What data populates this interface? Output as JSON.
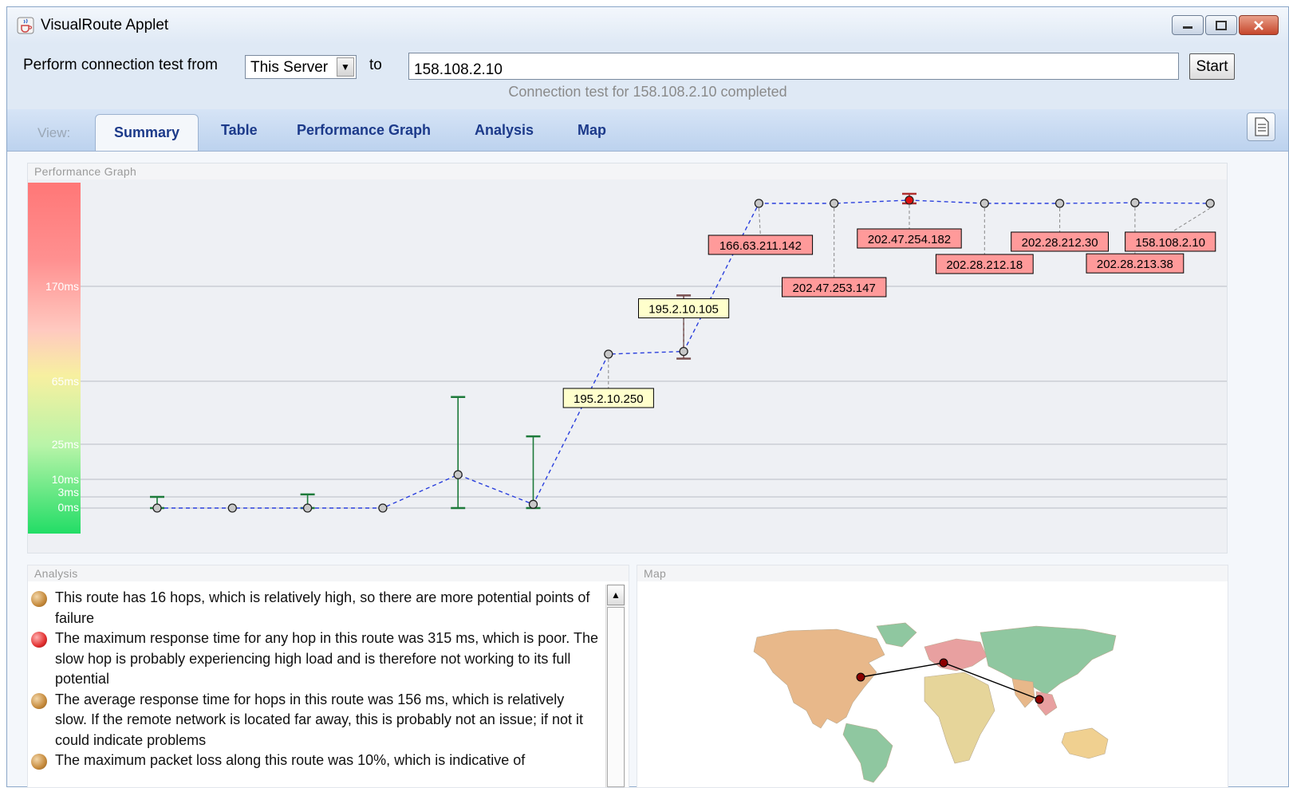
{
  "window": {
    "title": "VisualRoute Applet",
    "app_icon": "java-cup-icon"
  },
  "connection": {
    "from_label": "Perform connection test from",
    "from_value": "This Server",
    "to_label": "to",
    "target": "158.108.2.10",
    "start_label": "Start",
    "status": "Connection test for 158.108.2.10 completed"
  },
  "view": {
    "label": "View:",
    "tabs": [
      {
        "label": "Summary",
        "active": true
      },
      {
        "label": "Table"
      },
      {
        "label": "Performance Graph"
      },
      {
        "label": "Analysis"
      },
      {
        "label": "Map"
      }
    ]
  },
  "graph": {
    "title": "Performance Graph",
    "y_ticks": [
      "0ms",
      "3ms",
      "10ms",
      "25ms",
      "65ms",
      "170ms"
    ],
    "colors": {
      "good": "#22dd66",
      "mid": "#f7f0a0",
      "bad": "#ff7777",
      "line": "#2a3fdd"
    },
    "hops": [
      {
        "hop": 1,
        "ms": 0,
        "min": 0,
        "max": 3,
        "label": ""
      },
      {
        "hop": 2,
        "ms": 0,
        "min": 0,
        "max": 0,
        "label": ""
      },
      {
        "hop": 3,
        "ms": 0,
        "min": 0,
        "max": 4,
        "label": ""
      },
      {
        "hop": 4,
        "ms": 0,
        "min": 0,
        "max": 0,
        "label": ""
      },
      {
        "hop": 5,
        "ms": 12,
        "min": 0,
        "max": 55,
        "label": ""
      },
      {
        "hop": 6,
        "ms": 1,
        "min": 0,
        "max": 30,
        "label": ""
      },
      {
        "hop": 7,
        "ms": 95,
        "min": 95,
        "max": 95,
        "label": "195.2.10.250"
      },
      {
        "hop": 8,
        "ms": 98,
        "min": 90,
        "max": 160,
        "label": "195.2.10.105"
      },
      {
        "hop": 9,
        "ms": 300,
        "min": 300,
        "max": 300,
        "label": "166.63.211.142"
      },
      {
        "hop": 10,
        "ms": 300,
        "min": 300,
        "max": 300,
        "label": "202.47.253.147"
      },
      {
        "hop": 11,
        "ms": 305,
        "min": 300,
        "max": 315,
        "label": "202.47.254.182"
      },
      {
        "hop": 12,
        "ms": 300,
        "min": 300,
        "max": 300,
        "label": "202.28.212.18"
      },
      {
        "hop": 13,
        "ms": 300,
        "min": 300,
        "max": 300,
        "label": "202.28.212.30"
      },
      {
        "hop": 14,
        "ms": 301,
        "min": 301,
        "max": 301,
        "label": "202.28.213.38"
      },
      {
        "hop": 15,
        "ms": 300,
        "min": 300,
        "max": 300,
        "label": "158.108.2.10"
      }
    ]
  },
  "analysis": {
    "title": "Analysis",
    "items": [
      {
        "severity": "warning",
        "text": "This route has 16 hops, which is relatively high, so there are more potential points of failure"
      },
      {
        "severity": "error",
        "text": "The maximum response time for any hop in this route was 315 ms, which is poor. The slow hop is probably experiencing high load and is therefore not working to its full potential"
      },
      {
        "severity": "warning",
        "text": "The average response time for hops in this route was 156 ms, which is relatively slow. If the remote network is located far away, this is probably not an issue; if not it could indicate problems"
      },
      {
        "severity": "warning",
        "text": "The maximum packet loss along this route was 10%, which is indicative of"
      }
    ]
  },
  "map": {
    "title": "Map"
  }
}
